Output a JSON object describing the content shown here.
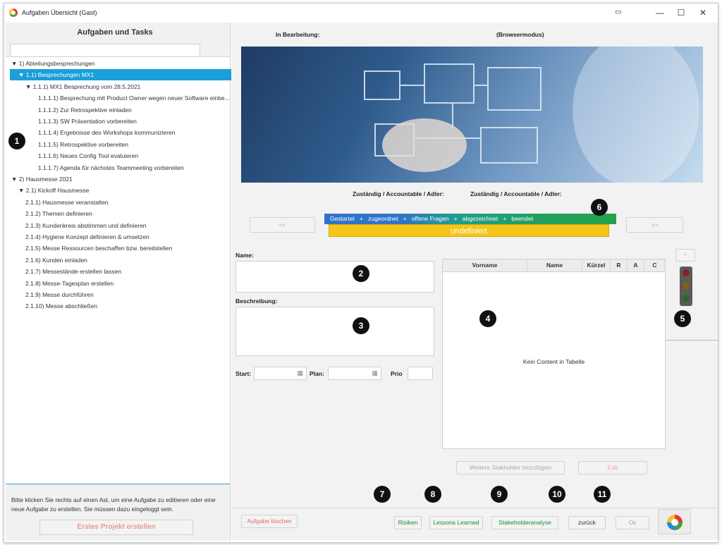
{
  "window": {
    "title": "Aufgaben Übersicht (Gast)",
    "controls": [
      "restore-icon",
      "minimize",
      "maximize",
      "close"
    ]
  },
  "left": {
    "heading": "Aufgaben und Tasks",
    "tree": [
      {
        "label": "▼ 1) Abteilungsbesprechungen",
        "indent": 0
      },
      {
        "label": "▼ 1.1) Besprechungen MX1",
        "indent": 1,
        "selected": true
      },
      {
        "label": "▼ 1.1.1) MX1 Besprechung vom 28.5.2021",
        "indent": 2
      },
      {
        "label": "1.1.1.1) Besprechung mit Product Owner wegen neuer Software einbe...",
        "indent": 3
      },
      {
        "label": "1.1.1.2) Zur Retrospektive einladen",
        "indent": 3
      },
      {
        "label": "1.1.1.3) SW Präsentation vorbereiten",
        "indent": 3
      },
      {
        "label": "1.1.1.4) Ergebnisse des Workshops kommunizieren",
        "indent": 3
      },
      {
        "label": "1.1.1.5) Retrospektive vorbereiten",
        "indent": 3
      },
      {
        "label": "1.1.1.6) Neues Config Tool evaluieren",
        "indent": 3
      },
      {
        "label": "1.1.1.7) Agenda für nächstes Teammeeting vorbereiten",
        "indent": 3
      },
      {
        "label": "▼ 2) Hausmesse 2021",
        "indent": 0
      },
      {
        "label": "▼ 2.1) Kickoff Hausmesse",
        "indent": 1
      },
      {
        "label": "2.1.1) Hausmesse veranstalten",
        "indent": 2
      },
      {
        "label": "2.1.2) Themen definieren",
        "indent": 2
      },
      {
        "label": "2.1.3) Kundenkreis abstimmen und definieren",
        "indent": 2
      },
      {
        "label": "2.1.4) Hygiene Konzept definieren & umsetzen",
        "indent": 2
      },
      {
        "label": "2.1.5) Messe Ressourcen beschaffen bzw. bereitstellen",
        "indent": 2
      },
      {
        "label": "2.1.6) Kunden einladen",
        "indent": 2
      },
      {
        "label": "2.1.7) Messestände erstellen lassen",
        "indent": 2
      },
      {
        "label": "2.1.8) Messe-Tagesplan erstellen",
        "indent": 2
      },
      {
        "label": "2.1.9) Messe durchführen",
        "indent": 2
      },
      {
        "label": "2.1.10) Messe abschließen",
        "indent": 2
      }
    ],
    "hint": "Bitte klicken Sie rechts auf einen Ast, um eine Aufgabe zu editieren oder eine neue Aufgabe zu erstellen. Sie müssen dazu eingeloggt sein.",
    "create_button": "Erstes Projekt erstellen"
  },
  "right": {
    "in_progress_label": "In Bearbeitung:",
    "mode_label": "(Browsermodus)",
    "responsible_label_1": "Zuständig / Accountable / Adler:",
    "responsible_label_2": "Zuständig / Accountable / Adler:",
    "prev_button": "<<",
    "next_button": ">>",
    "status_steps": "Gestartet   +   zugeordnet   +   offene Fragen   +   abgezeichnet   +   beendet",
    "status_value": "undefiniert",
    "name_label": "Name:",
    "description_label": "Beschreibung:",
    "start_label": "Start:",
    "plan_label": "Plan:",
    "prio_label": "Prio",
    "table_headers": [
      "Vorname",
      "Name",
      "Kürzel",
      "R",
      "A",
      "C"
    ],
    "table_empty": "Kein Content in Tabelle",
    "up_button": "^",
    "add_stakeholder_button": "Weitere Stakholder hinzufügen",
    "edit_button": "Edit",
    "delete_button": "Aufgabe löschen",
    "risks_button": "Risiken",
    "lessons_button": "Lessons Learned",
    "stakeholder_button": "Stakeholderanalyse",
    "back_button": "zurück",
    "ok_button": "Ok"
  },
  "callouts": [
    "1",
    "2",
    "3",
    "4",
    "5",
    "6",
    "7",
    "8",
    "9",
    "10",
    "11"
  ],
  "colors": {
    "selection": "#1a9fd8",
    "status_yellow": "#f5c518",
    "status_blue": "#2f74c8",
    "status_green": "#25a24b"
  }
}
